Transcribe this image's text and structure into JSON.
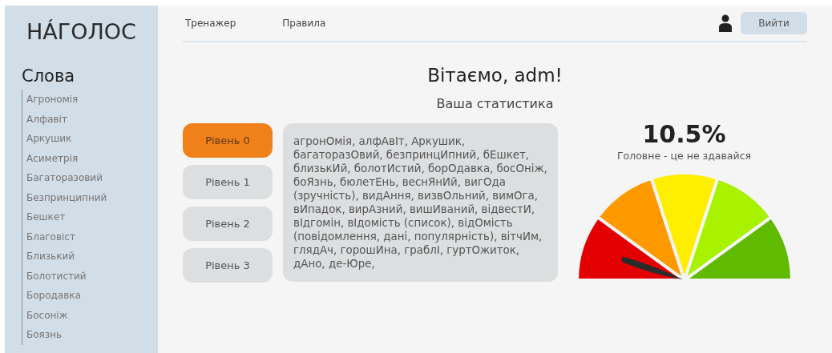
{
  "logo": "НÁГОЛОС",
  "sidebar": {
    "title": "Слова",
    "items": [
      "Агрономія",
      "Алфавіт",
      "Аркушик",
      "Асиметрія",
      "Багаторазовий",
      "Безпринципний",
      "Бешкет",
      "Благовіст",
      "Близький",
      "Болотистий",
      "Бородавка",
      "Босоніж",
      "Боязнь"
    ]
  },
  "nav": {
    "links": [
      "Тренажер",
      "Правила"
    ],
    "logout": "Вийти"
  },
  "greeting": "Вітаємо, adm!",
  "subtitle": "Ваша статистика",
  "levels": [
    {
      "label": "Рівень 0",
      "selected": true
    },
    {
      "label": "Рівень 1",
      "selected": false
    },
    {
      "label": "Рівень 2",
      "selected": false
    },
    {
      "label": "Рівень 3",
      "selected": false
    }
  ],
  "words": "агронОмія, алфАвІт, Аркушик, багаторазОвий, безпринцИпний, бЕшкет, близькИй, болотИстий, борОдавка, босОніж, боЯзнь, бюлетЕнь, веснЯнИй, вигОда (зручність), видАння, визвОльний, вимОга, вИпадок, вирАзний, вишИваний, відвестИ, вІдгомін, вІдомість (список), відОмість (повідомлення, дані, популярність), вітчИм, глядАч, горошИна, граблІ, гуртОжиток, дАно, де-Юре,",
  "gauge": {
    "value": "10.5%",
    "caption": "Головне - це не здавайся",
    "segments": [
      {
        "color": "#e30000"
      },
      {
        "color": "#ff9900"
      },
      {
        "color": "#ffee00"
      },
      {
        "color": "#a8f200"
      },
      {
        "color": "#5fba00"
      }
    ]
  }
}
